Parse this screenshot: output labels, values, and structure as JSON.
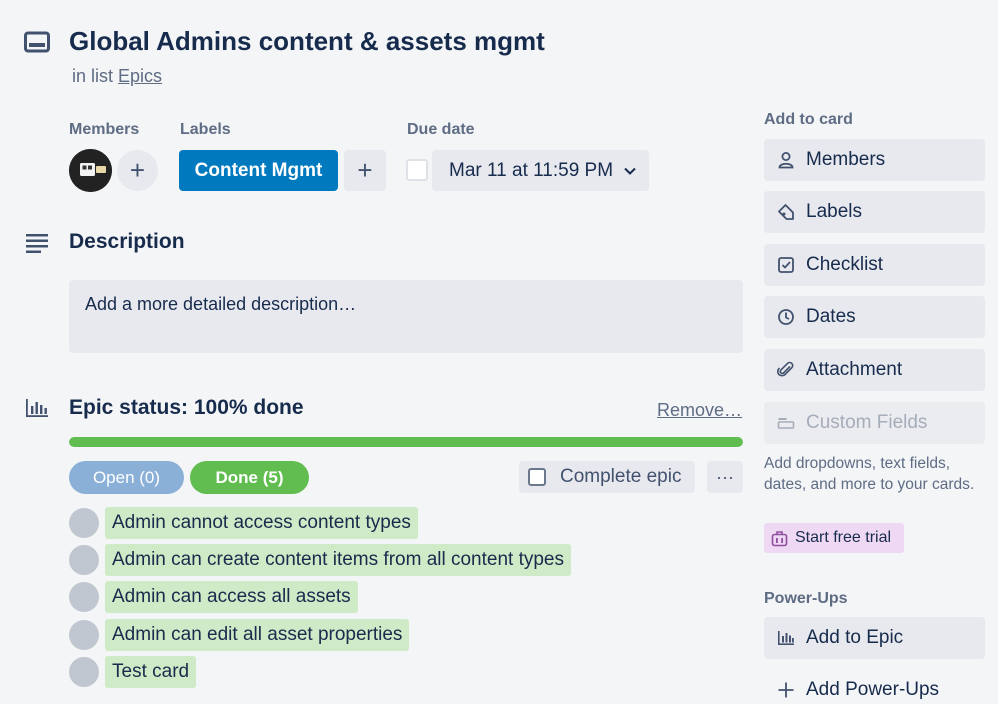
{
  "card": {
    "title": "Global Admins content & assets mgmt",
    "in_list_prefix": "in list",
    "list_name": "Epics"
  },
  "members": {
    "label": "Members",
    "add_symbol": "+"
  },
  "labels": {
    "label": "Labels",
    "items": [
      {
        "text": "Content Mgmt",
        "color": "#0079bf"
      }
    ],
    "add_symbol": "+"
  },
  "due_date": {
    "label": "Due date",
    "value": "Mar 11 at 11:59 PM",
    "checked": false
  },
  "description": {
    "title": "Description",
    "placeholder": "Add a more detailed description…"
  },
  "epic": {
    "title": "Epic status: 100% done",
    "remove_label": "Remove…",
    "progress_percent": 100,
    "tabs": {
      "open": "Open (0)",
      "done": "Done (5)"
    },
    "complete_label": "Complete epic",
    "more_symbol": "···",
    "cards": [
      "Admin cannot access content types",
      "Admin can create content items from all content types",
      "Admin can access all assets",
      "Admin can edit all asset properties",
      "Test card"
    ]
  },
  "sidebar": {
    "add_to_card_title": "Add to card",
    "buttons": [
      {
        "label": "Members",
        "icon": "person-icon"
      },
      {
        "label": "Labels",
        "icon": "tag-icon"
      },
      {
        "label": "Checklist",
        "icon": "checkbox-icon"
      },
      {
        "label": "Dates",
        "icon": "clock-icon"
      },
      {
        "label": "Attachment",
        "icon": "paperclip-icon"
      },
      {
        "label": "Custom Fields",
        "icon": "custom-fields-icon",
        "disabled": true
      }
    ],
    "custom_fields_note": "Add dropdowns, text fields, dates, and more to your cards.",
    "trial_label": "Start free trial",
    "powerups_title": "Power-Ups",
    "add_to_epic_label": "Add to Epic",
    "add_powerups_label": "Add Power-Ups"
  },
  "colors": {
    "accent_blue": "#0079bf",
    "success_green": "#61bd4f",
    "chip_green": "#cfeac6",
    "trial_purple": "#efd8f3"
  }
}
